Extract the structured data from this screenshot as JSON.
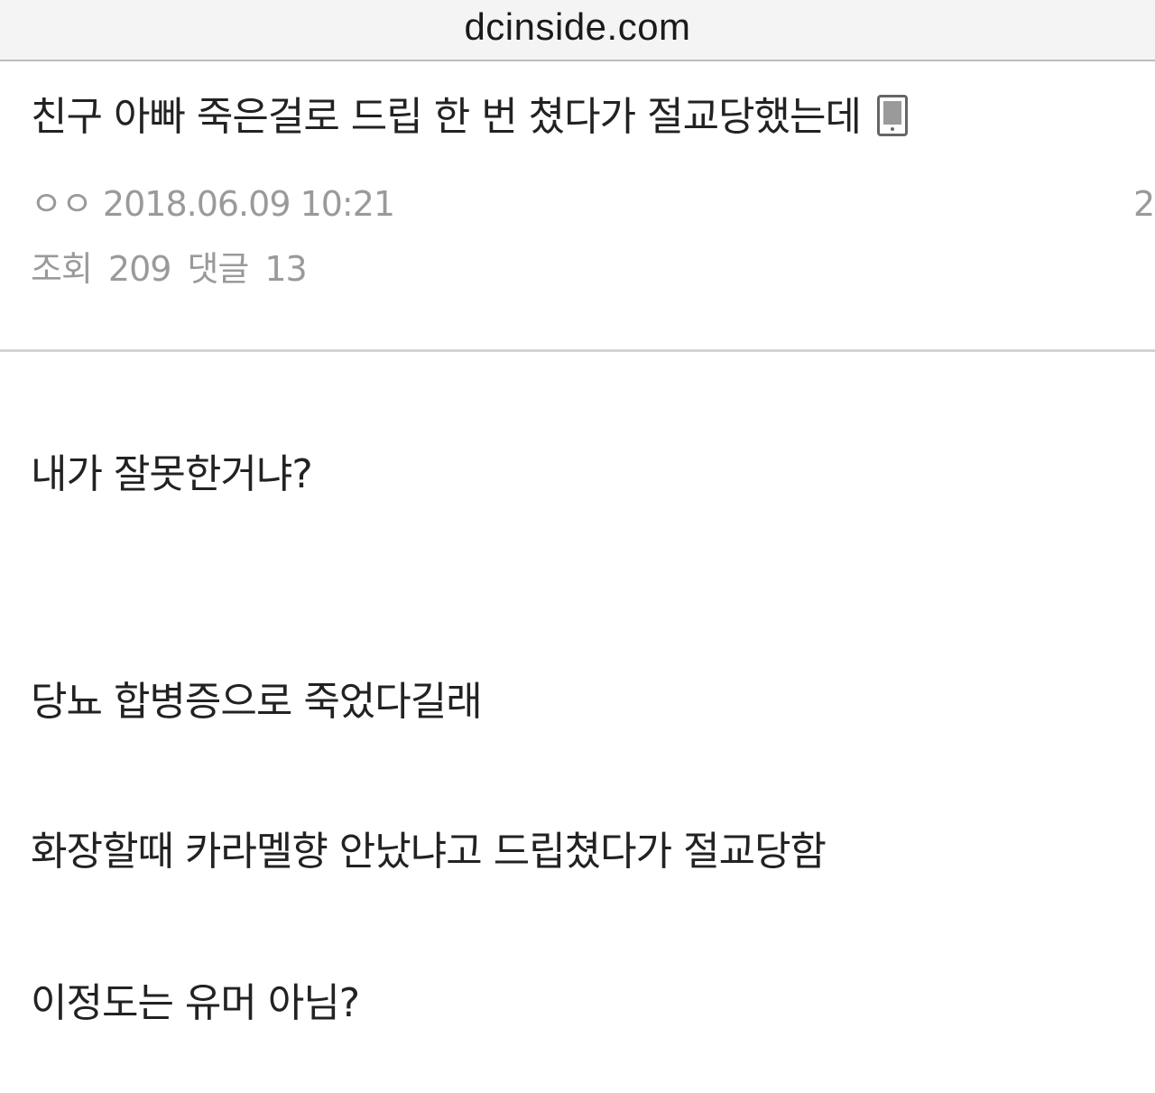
{
  "browser": {
    "url": "dcinside.com"
  },
  "post": {
    "title": "친구 아빠 죽은걸로 드립 한 번 쳤다가 절교당했는데",
    "title_icon": "mobile-phone-icon",
    "author": "ㅇㅇ",
    "datetime": "2018.06.09 10:21",
    "meta_right_partial": "2",
    "views_label": "조회",
    "views_value": "209",
    "comments_label": "댓글",
    "comments_value": "13"
  },
  "body": {
    "lines": [
      "내가 잘못한거냐?",
      "당뇨 합병증으로 죽었다길래",
      "화장할때 카라멜향 안났냐고 드립쳤다가 절교당함",
      "이정도는 유머 아님?"
    ]
  },
  "colors": {
    "text": "#222222",
    "meta": "#9a9a9a",
    "divider": "#d4d4d4",
    "url_bar_bg": "#f4f4f4"
  }
}
